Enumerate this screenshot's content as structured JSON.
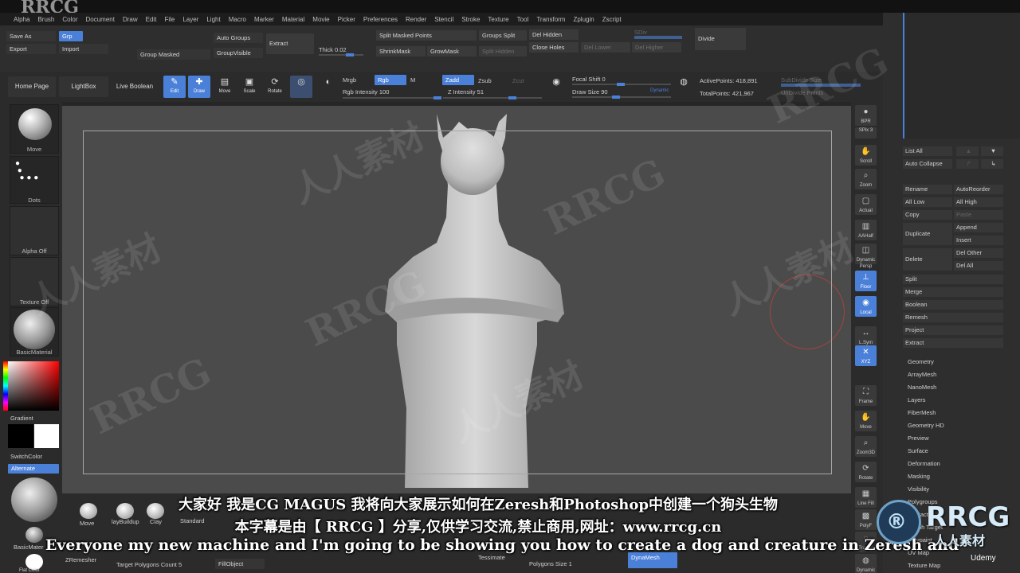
{
  "brand": {
    "top_logo": "RRCG",
    "corner_logo": "RRCG",
    "corner_sub": "人人素材",
    "udemy": "Udemy"
  },
  "menu": [
    "Alpha",
    "Brush",
    "Color",
    "Document",
    "Draw",
    "Edit",
    "File",
    "Layer",
    "Light",
    "Macro",
    "Marker",
    "Material",
    "Movie",
    "Picker",
    "Preferences",
    "Render",
    "Stencil",
    "Stroke",
    "Texture",
    "Tool",
    "Transform",
    "Zplugin",
    "Zscript"
  ],
  "toolbar1": {
    "save_as": "Save As",
    "grp": "Grp",
    "export": "Export",
    "import": "Import",
    "group_masked": "Group Masked",
    "auto_groups": "Auto Groups",
    "group_visible": "GroupVisible",
    "extract": "Extract",
    "thick": "Thick 0.02",
    "split_masked": "Split Masked Points",
    "groups_split": "Groups Split",
    "del_hidden": "Del Hidden",
    "sdiv": "SDiv",
    "divide": "Divide",
    "shrink_mask": "ShrinkMask",
    "grow_mask": "GrowMask",
    "split_hidden": "Split Hidden",
    "close_holes": "Close Holes",
    "del_lower": "Del Lower",
    "del_higher": "Del Higher"
  },
  "toolbar2": {
    "home": "Home Page",
    "lightbox": "LightBox",
    "live_boolean": "Live Boolean",
    "edit": "Edit",
    "draw": "Draw",
    "move": "Move",
    "scale": "Scale",
    "rotate": "Rotate",
    "mrgb": "Mrgb",
    "rgb": "Rgb",
    "m": "M",
    "rgb_intensity": "Rgb Intensity 100",
    "zadd": "Zadd",
    "zsub": "Zsub",
    "zcut": "Zcut",
    "z_intensity": "Z Intensity 51",
    "focal_shift": "Focal Shift 0",
    "draw_size": "Draw Size 90",
    "dynamic": "Dynamic",
    "active_points": "ActivePoints: 418,891",
    "total_points": "TotalPoints: 421,967",
    "subdiv_size": "SubDivide Size",
    "undivide": "UnDivide Points"
  },
  "left_panel": {
    "move": "Move",
    "dots": "Dots",
    "alpha_off": "Alpha Off",
    "texture_off": "Texture Off",
    "basic_material": "BasicMaterial",
    "gradient": "Gradient",
    "switch_color": "SwitchColor",
    "alternate": "Alternate",
    "basic_material2": "BasicMater",
    "flat_color": "Flat Color"
  },
  "bottom_bar": {
    "move": "Move",
    "clay_buildup": "layBuildup",
    "clay": "Clay",
    "standard": "Standard",
    "zremesher": "ZRemesher",
    "target_polys": "Target Polygons Count 5",
    "fill_object": "FillObject",
    "tessimate": "Tessimate",
    "polygons_size": "Polygons Size 1",
    "dynamesh": "DynaMesh"
  },
  "right_tools": [
    "BPR",
    "SPix 3",
    "Scroll",
    "Zoom",
    "Actual",
    "AAHalf",
    "Dynamic Persp",
    "Floor",
    "Local",
    "L.Sym",
    "XYZ",
    "Frame",
    "Move",
    "Zoom3D",
    "Rotate",
    "Line Fill",
    "PolyF",
    "Transp",
    "Dynamic"
  ],
  "subtool_panel": {
    "list_all": "List All",
    "auto_collapse": "Auto Collapse",
    "rename": "Rename",
    "auto_reorder": "AutoReorder",
    "all_low": "All Low",
    "all_high": "All High",
    "copy": "Copy",
    "paste": "Paste",
    "duplicate": "Duplicate",
    "append": "Append",
    "insert": "Insert",
    "delete": "Delete",
    "del_other": "Del Other",
    "del_all": "Del All",
    "split": "Split",
    "merge": "Merge",
    "boolean": "Boolean",
    "remesh": "Remesh",
    "project": "Project",
    "extract": "Extract",
    "sections": [
      "Geometry",
      "ArrayMesh",
      "NanoMesh",
      "Layers",
      "FiberMesh",
      "Geometry HD",
      "Preview",
      "Surface",
      "Deformation",
      "Masking",
      "Visibility",
      "Polygroups",
      "Contact",
      "Morph Target",
      "Polypaint",
      "UV Map",
      "Texture Map"
    ]
  },
  "subtitles": {
    "line1": "大家好 我是CG MAGUS 我将向大家展示如何在Zeresh和Photoshop中创建一个狗头生物",
    "line2": "本字幕是由【 RRCG 】分享,仅供学习交流,禁止商用,网址：www.rrcg.cn",
    "line3": "Everyone my new machine and I'm going to be showing you how to create a dog and creature in Zeresh and"
  },
  "colors": {
    "accent": "#4a80d8",
    "bg": "#2b2b2b",
    "canvas": "#4b4b4b"
  }
}
